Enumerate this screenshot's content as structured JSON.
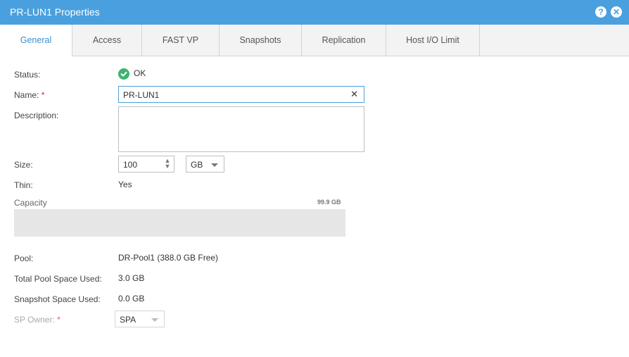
{
  "window": {
    "title": "PR-LUN1 Properties",
    "help_icon": "?",
    "close_icon": "✕"
  },
  "tabs": [
    {
      "label": "General",
      "active": true
    },
    {
      "label": "Access"
    },
    {
      "label": "FAST VP"
    },
    {
      "label": "Snapshots"
    },
    {
      "label": "Replication"
    },
    {
      "label": "Host I/O Limit"
    }
  ],
  "general": {
    "status_label": "Status:",
    "status_value": "OK",
    "name_label": "Name:",
    "required_marker": "*",
    "name_value": "PR-LUN1",
    "description_label": "Description:",
    "description_value": "",
    "size_label": "Size:",
    "size_value": "100",
    "size_unit": "GB",
    "thin_label": "Thin:",
    "thin_value": "Yes",
    "capacity_label": "Capacity",
    "capacity_value": "99.9 GB",
    "pool_label": "Pool:",
    "pool_value": "DR-Pool1 (388.0 GB Free)",
    "total_pool_label": "Total Pool Space Used:",
    "total_pool_value": "3.0 GB",
    "snapshot_label": "Snapshot Space Used:",
    "snapshot_value": "0.0 GB",
    "sp_owner_label": "SP Owner:",
    "sp_owner_value": "SPA"
  },
  "colors": {
    "accent": "#4aa0de",
    "ok": "#3cb46e",
    "required": "#dd2222"
  }
}
